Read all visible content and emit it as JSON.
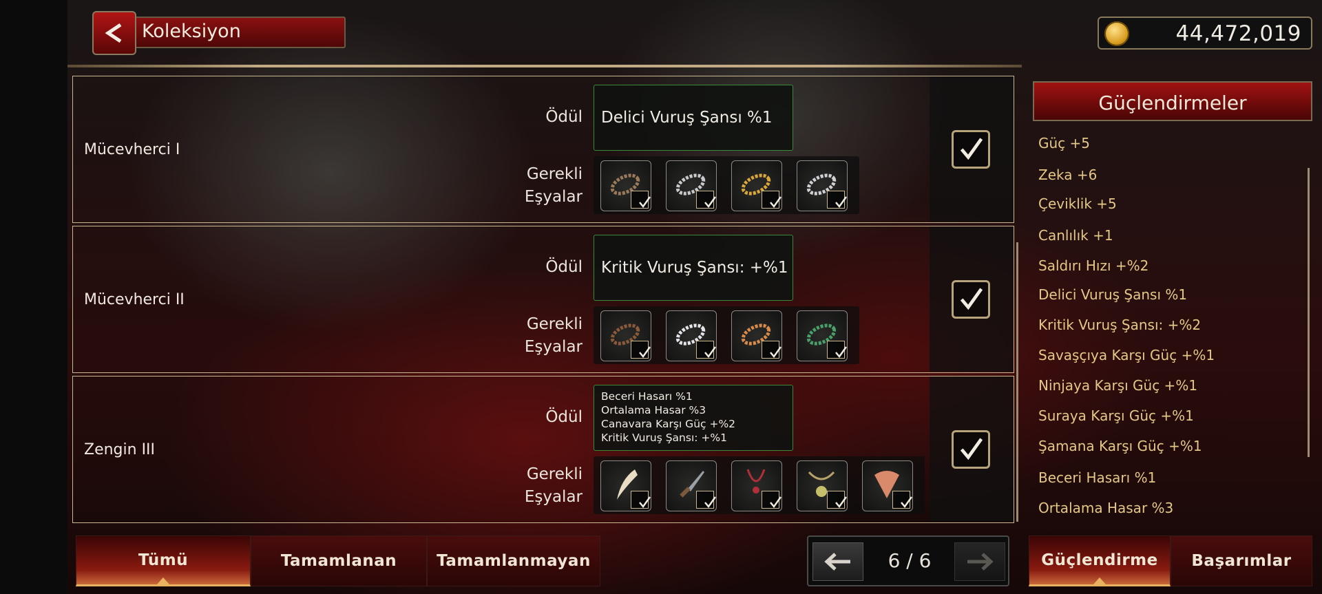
{
  "header": {
    "title": "Koleksiyon",
    "gold": "44,472,019",
    "back_icon": "chevron-left-icon",
    "currency_icon": "gold-coin-icon"
  },
  "collections": [
    {
      "name": "Mücevherci I",
      "reward_label": "Ödül",
      "reward": [
        "Delici Vuruş Şansı %1"
      ],
      "required_label_1": "Gerekli",
      "required_label_2": "Eşyalar",
      "items": [
        "bracelet-brown-icon",
        "bracelet-silver-icon",
        "bracelet-gold-icon",
        "bracelet-coil-icon"
      ],
      "completed": true
    },
    {
      "name": "Mücevherci II",
      "reward_label": "Ödül",
      "reward": [
        "Kritik Vuruş Şansı: +%1"
      ],
      "required_label_1": "Gerekli",
      "required_label_2": "Eşyalar",
      "items": [
        "bracelet-beads-icon",
        "bracelet-pearl-icon",
        "bracelet-bronze-icon",
        "bracelet-jade-icon"
      ],
      "completed": true
    },
    {
      "name": "Zengin III",
      "reward_label": "Ödül",
      "reward": [
        "Beceri Hasarı %1",
        "Ortalama Hasar %3",
        "Canavara Karşı Güç +%2",
        "Kritik Vuruş Şansı: +%1"
      ],
      "required_label_1": "Gerekli",
      "required_label_2": "Eşyalar",
      "items": [
        "tusk-icon",
        "dagger-icon",
        "red-necklace-icon",
        "amulet-icon",
        "feather-fan-icon"
      ],
      "completed": true
    }
  ],
  "side_panel": {
    "title": "Güçlendirmeler",
    "bonuses": [
      "Güç +5",
      "Zeka +6",
      "Çeviklik +5",
      "Canlılık +1",
      "Saldırı Hızı +%2",
      "Delici Vuruş Şansı %1",
      "Kritik Vuruş Şansı: +%2",
      "Savaşçıya Karşı Güç +%1",
      "Ninjaya Karşı Güç +%1",
      "Suraya Karşı Güç +%1",
      "Şamana Karşı Güç +%1",
      "Beceri Hasarı %1",
      "Ortalama Hasar %3"
    ]
  },
  "filters": {
    "all": "Tümü",
    "completed": "Tamamlanan",
    "incomplete": "Tamamlanmayan",
    "active": "all"
  },
  "pager": {
    "text": "6 / 6",
    "prev_icon": "arrow-left-icon",
    "next_icon": "arrow-right-icon"
  },
  "side_tabs": {
    "boosts": "Güçlendirme",
    "achievements": "Başarımlar",
    "active": "boosts"
  },
  "colors": {
    "accent_red": "#8a1010",
    "gold_text": "#e4c887",
    "border_gold": "#cbb892",
    "reward_border": "#3a8a3a"
  }
}
